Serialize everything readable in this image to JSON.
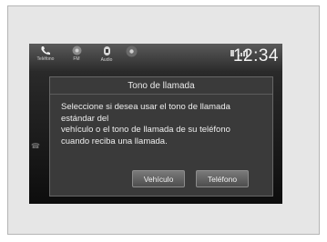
{
  "status_bar": {
    "phone_label": "Teléfono",
    "fm_label": "FM",
    "audio_label": "Audio",
    "clock": "12:34"
  },
  "dialog": {
    "title": "Tono de llamada",
    "message_lines": [
      "Seleccione si desea usar el tono de llamada",
      "estándar del",
      "vehículo o el tono de llamada de su teléfono",
      "cuando reciba una llamada."
    ],
    "vehicle_button": "Vehículo",
    "phone_button": "Teléfono"
  },
  "icons": [
    "phone-icon",
    "radio-icon",
    "audio-icon",
    "voice-icon",
    "signal-icon",
    "battery-icon"
  ],
  "colors": {
    "screen_background": "#131313",
    "dialog_background": "#3a3a3a",
    "button": "#6a6a6a",
    "text": "#eeeeee"
  }
}
